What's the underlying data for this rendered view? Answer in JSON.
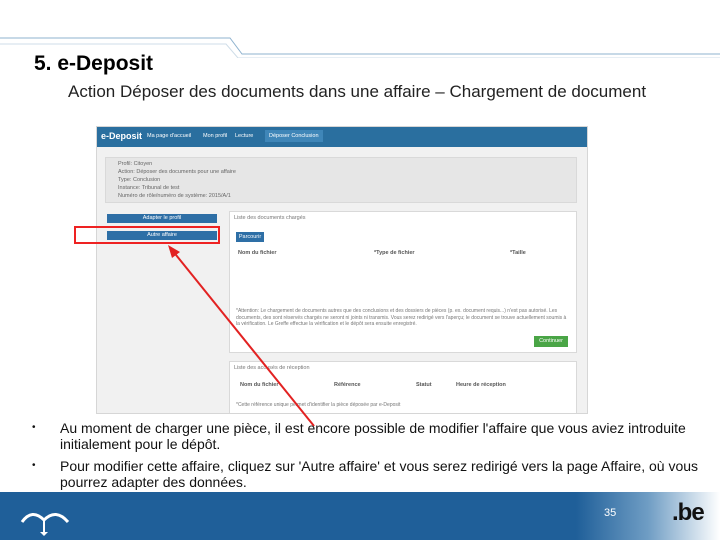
{
  "slide": {
    "title": "5.  e-Deposit",
    "subtitle": "Action Déposer des documents dans une affaire – Chargement de document",
    "page_number": "35",
    "logo_text": ".be"
  },
  "app": {
    "brand": "e-Deposit",
    "nav": [
      "Ma page d'accueil",
      "Mon profil",
      "Lecture",
      "Déposer Conclusion"
    ],
    "info": [
      "Profil: Citoyen",
      "Action: Déposer des documents pour une affaire",
      "Type: Conclusion",
      "Instance: Tribunal de test",
      "Numéro de rôle/numéro de système: 2015/A/1"
    ],
    "adapt_profile_button": "Adapter le profil",
    "other_affair_button": "Autre affaire",
    "uploaded_list_title": "Liste des documents chargés",
    "browse_button": "Parcourir",
    "columns_uploaded": [
      "Nom du fichier",
      "*Type de fichier",
      "*Taille"
    ],
    "attention_note": "*Attention: Le chargement de documents autres que des conclusions et des dossiers de pièces (p. ex. document requis...) n'est pas autorisé. Les documents, des sont réservés chargés ne seront ni joints ni transmis. Vous serez redirigé vers l'aperçu; le document se trouve actuellement soumis à la vérification. Le Greffe effectue la vérification et le dépôt sera ensuite enregistré.",
    "continue_button": "Continuer",
    "receipts_title": "Liste des accusés de réception",
    "columns_receipts": [
      "Nom du fichier",
      "Référence",
      "Statut",
      "Heure de réception"
    ],
    "receipt_note": "*Cette référence unique permet d'identifier la pièce déposée par e-Deposit"
  },
  "bullets": [
    "Au moment de charger une pièce, il est encore possible de modifier l'affaire que vous aviez introduite initialement pour le dépôt.",
    "Pour modifier cette affaire, cliquez sur 'Autre affaire' et vous serez redirigé vers la page Affaire, où vous pourrez adapter des données."
  ],
  "colors": {
    "accent_blue": "#1f5f99",
    "button_blue": "#2e6fa6",
    "annotation_red": "#e22222",
    "continue_green": "#4aa546"
  }
}
